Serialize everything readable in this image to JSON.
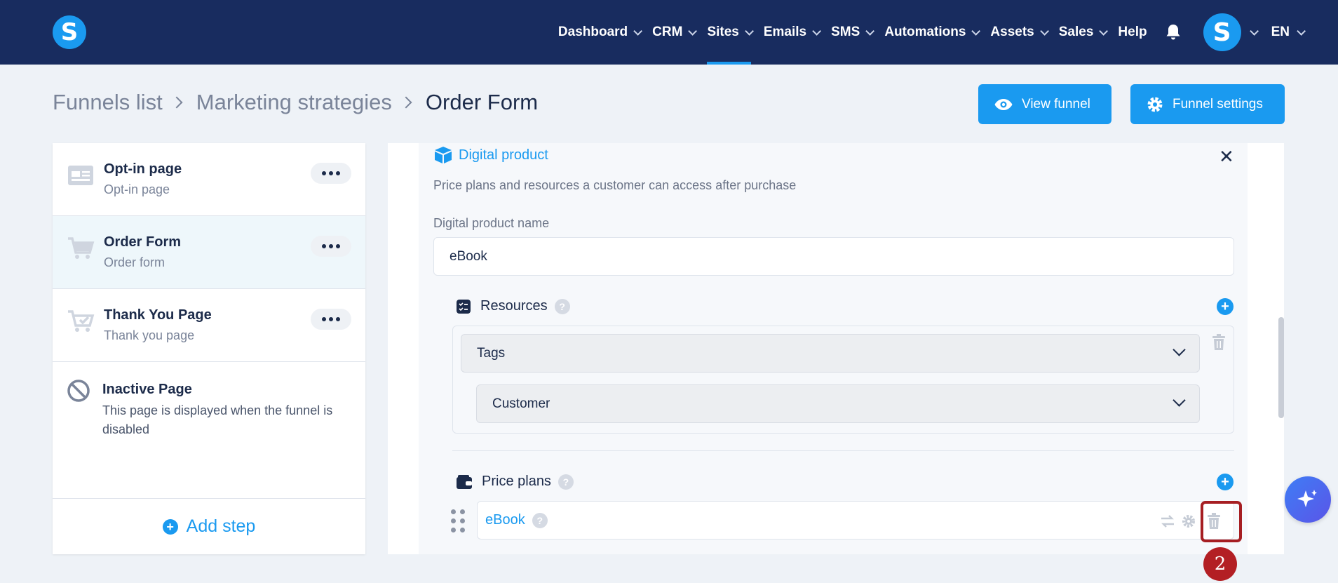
{
  "app": {
    "logo_letter": "S",
    "brand_color": "#1a9af0",
    "nav_bg": "#182c5f"
  },
  "nav": {
    "items": [
      {
        "label": "Dashboard",
        "has_dropdown": true
      },
      {
        "label": "CRM",
        "has_dropdown": true
      },
      {
        "label": "Sites",
        "has_dropdown": true,
        "active": true
      },
      {
        "label": "Emails",
        "has_dropdown": true
      },
      {
        "label": "SMS",
        "has_dropdown": true
      },
      {
        "label": "Automations",
        "has_dropdown": true
      },
      {
        "label": "Assets",
        "has_dropdown": true
      },
      {
        "label": "Sales",
        "has_dropdown": true
      },
      {
        "label": "Help",
        "has_dropdown": false
      }
    ],
    "bell_icon": "bell-icon",
    "avatar_letter": "S",
    "language": "EN"
  },
  "breadcrumb": {
    "items": [
      "Funnels list",
      "Marketing strategies",
      "Order Form"
    ]
  },
  "header_buttons": {
    "view_funnel": "View funnel",
    "funnel_settings": "Funnel settings"
  },
  "steps": [
    {
      "title": "Opt-in page",
      "subtitle": "Opt-in page",
      "icon": "opt-in-page-icon"
    },
    {
      "title": "Order Form",
      "subtitle": "Order form",
      "icon": "cart-icon",
      "selected": true
    },
    {
      "title": "Thank You Page",
      "subtitle": "Thank you page",
      "icon": "cart-check-icon"
    }
  ],
  "inactive_page": {
    "title": "Inactive Page",
    "description": "This page is displayed when the funnel is disabled"
  },
  "add_step": "Add step",
  "digital_product": {
    "heading": "Digital product",
    "description": "Price plans and resources a customer can access after purchase",
    "name_label": "Digital product name",
    "name_value": "eBook",
    "resources": {
      "label": "Resources",
      "type_select": "Tags",
      "value_select": "Customer"
    },
    "price_plans": {
      "label": "Price plans",
      "plans": [
        {
          "name": "eBook"
        }
      ]
    }
  },
  "annotation": {
    "marker": "2",
    "color": "#a61e22"
  }
}
